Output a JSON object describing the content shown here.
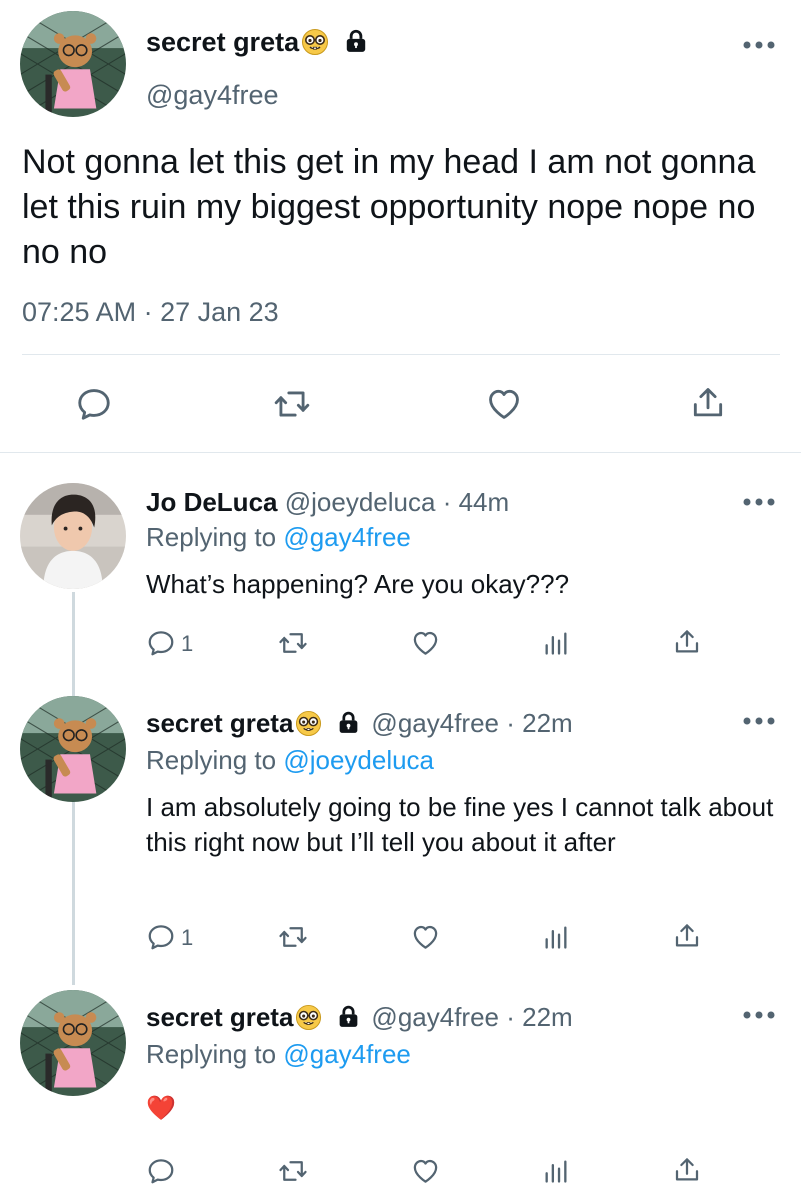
{
  "main_tweet": {
    "display_name": "secret greta",
    "name_emoji": "🤓",
    "handle": "@gay4free",
    "text": "Not gonna let this get in my head I am not gonna let this ruin my biggest opportunity nope nope no no no",
    "timestamp": "07:25 AM · 27 Jan 23"
  },
  "replies": [
    {
      "display_name": "Jo DeLuca",
      "handle": "@joeydeluca",
      "time": "· 44m",
      "replying_prefix": "Replying to ",
      "replying_to": "@gay4free",
      "text": "What’s happening? Are you okay???",
      "reply_count": "1"
    },
    {
      "display_name": "secret greta",
      "name_emoji": "🤓",
      "handle": "@gay4free",
      "time": "· 22m",
      "replying_prefix": "Replying to ",
      "replying_to": "@joeydeluca",
      "text": "I am absolutely going to be fine yes I cannot talk about this right now but I’ll tell you about it after",
      "reply_count": "1"
    },
    {
      "display_name": "secret greta",
      "name_emoji": "🤓",
      "handle": "@gay4free",
      "time": "· 22m",
      "replying_prefix": "Replying to ",
      "replying_to": "@gay4free",
      "text": "❤️",
      "reply_count": ""
    }
  ],
  "icons": {
    "reply": "reply-icon",
    "retweet": "retweet-icon",
    "like": "heart-icon",
    "share": "share-icon",
    "views": "views-icon",
    "more": "more-icon",
    "lock": "lock-icon"
  },
  "colors": {
    "text": "#0f1419",
    "secondary": "#536471",
    "link": "#1d9bf0",
    "divider": "#e1e8ed",
    "heart": "#e0245e"
  }
}
